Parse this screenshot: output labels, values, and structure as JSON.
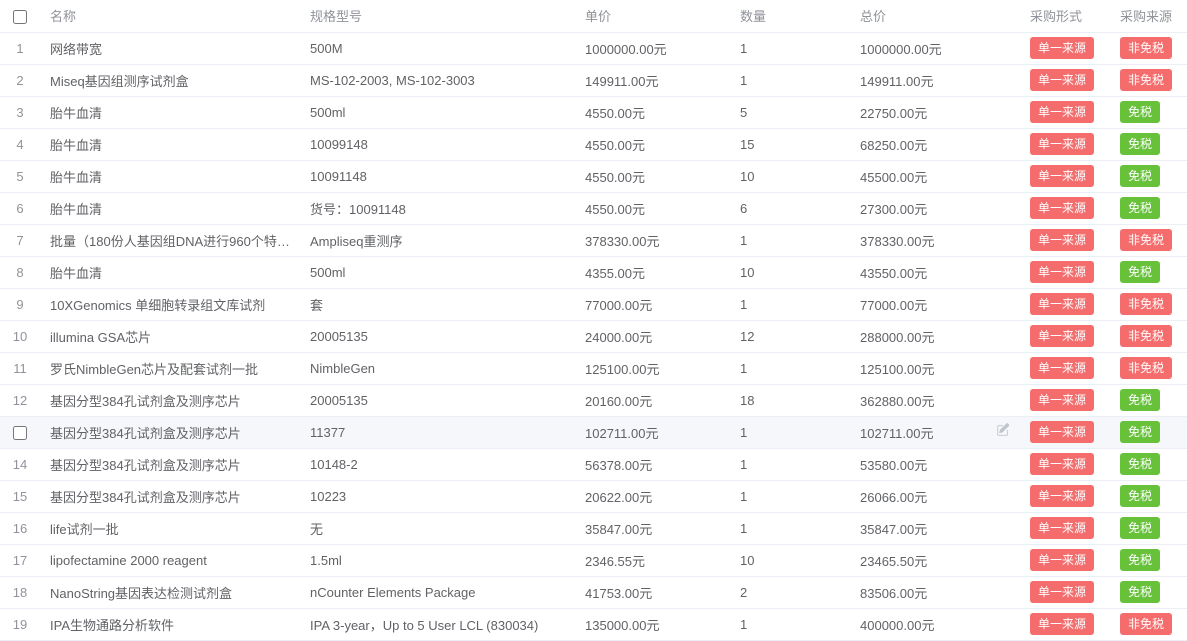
{
  "headers": {
    "name": "名称",
    "spec": "规格型号",
    "price": "单价",
    "qty": "数量",
    "total": "总价",
    "form": "采购形式",
    "source": "采购来源"
  },
  "tags": {
    "single_source": "单一来源",
    "non_exempt": "非免税",
    "exempt": "免税"
  },
  "rows": [
    {
      "idx": "1",
      "name": "网络带宽",
      "spec": "500M",
      "price": "1000000.00元",
      "qty": "1",
      "total": "1000000.00元",
      "form": "single_source",
      "source": "non_exempt"
    },
    {
      "idx": "2",
      "name": "Miseq基因组测序试剂盒",
      "spec": "MS-102-2003, MS-102-3003",
      "price": "149911.00元",
      "qty": "1",
      "total": "149911.00元",
      "form": "single_source",
      "source": "non_exempt"
    },
    {
      "idx": "3",
      "name": "胎牛血清",
      "spec": "500ml",
      "price": "4550.00元",
      "qty": "5",
      "total": "22750.00元",
      "form": "single_source",
      "source": "exempt"
    },
    {
      "idx": "4",
      "name": "胎牛血清",
      "spec": "10099148",
      "price": "4550.00元",
      "qty": "15",
      "total": "68250.00元",
      "form": "single_source",
      "source": "exempt"
    },
    {
      "idx": "5",
      "name": "胎牛血清",
      "spec": "10091148",
      "price": "4550.00元",
      "qty": "10",
      "total": "45500.00元",
      "form": "single_source",
      "source": "exempt"
    },
    {
      "idx": "6",
      "name": "胎牛血清",
      "spec": "货号：10091148",
      "price": "4550.00元",
      "qty": "6",
      "total": "27300.00元",
      "form": "single_source",
      "source": "exempt"
    },
    {
      "idx": "7",
      "name": "批量（180份人基因组DNA进行960个特定...",
      "spec": "Ampliseq重测序",
      "price": "378330.00元",
      "qty": "1",
      "total": "378330.00元",
      "form": "single_source",
      "source": "non_exempt"
    },
    {
      "idx": "8",
      "name": "胎牛血清",
      "spec": "500ml",
      "price": "4355.00元",
      "qty": "10",
      "total": "43550.00元",
      "form": "single_source",
      "source": "exempt"
    },
    {
      "idx": "9",
      "name": "10XGenomics 单细胞转录组文库试剂",
      "spec": "套",
      "price": "77000.00元",
      "qty": "1",
      "total": "77000.00元",
      "form": "single_source",
      "source": "non_exempt"
    },
    {
      "idx": "10",
      "name": "illumina GSA芯片",
      "spec": "20005135",
      "price": "24000.00元",
      "qty": "12",
      "total": "288000.00元",
      "form": "single_source",
      "source": "non_exempt"
    },
    {
      "idx": "11",
      "name": "罗氏NimbleGen芯片及配套试剂一批",
      "spec": "NimbleGen",
      "price": "125100.00元",
      "qty": "1",
      "total": "125100.00元",
      "form": "single_source",
      "source": "non_exempt"
    },
    {
      "idx": "12",
      "name": "基因分型384孔试剂盒及测序芯片",
      "spec": "20005135",
      "price": "20160.00元",
      "qty": "18",
      "total": "362880.00元",
      "form": "single_source",
      "source": "exempt"
    },
    {
      "idx": "",
      "name": "基因分型384孔试剂盒及测序芯片",
      "spec": "11377",
      "price": "102711.00元",
      "qty": "1",
      "total": "102711.00元",
      "form": "single_source",
      "source": "exempt",
      "hovered": true,
      "editable": true,
      "checkbox": true
    },
    {
      "idx": "14",
      "name": "基因分型384孔试剂盒及测序芯片",
      "spec": "10148-2",
      "price": "56378.00元",
      "qty": "1",
      "total": "53580.00元",
      "form": "single_source",
      "source": "exempt"
    },
    {
      "idx": "15",
      "name": "基因分型384孔试剂盒及测序芯片",
      "spec": "10223",
      "price": "20622.00元",
      "qty": "1",
      "total": "26066.00元",
      "form": "single_source",
      "source": "exempt"
    },
    {
      "idx": "16",
      "name": "life试剂一批",
      "spec": "无",
      "price": "35847.00元",
      "qty": "1",
      "total": "35847.00元",
      "form": "single_source",
      "source": "exempt"
    },
    {
      "idx": "17",
      "name": "lipofectamine 2000 reagent",
      "spec": "1.5ml",
      "price": "2346.55元",
      "qty": "10",
      "total": "23465.50元",
      "form": "single_source",
      "source": "exempt"
    },
    {
      "idx": "18",
      "name": "NanoString基因表达检测试剂盒",
      "spec": "nCounter Elements Package",
      "price": "41753.00元",
      "qty": "2",
      "total": "83506.00元",
      "form": "single_source",
      "source": "exempt"
    },
    {
      "idx": "19",
      "name": "IPA生物通路分析软件",
      "spec": "IPA 3-year，Up to 5 User LCL (830034)",
      "price": "135000.00元",
      "qty": "1",
      "total": "400000.00元",
      "form": "single_source",
      "source": "non_exempt"
    }
  ]
}
